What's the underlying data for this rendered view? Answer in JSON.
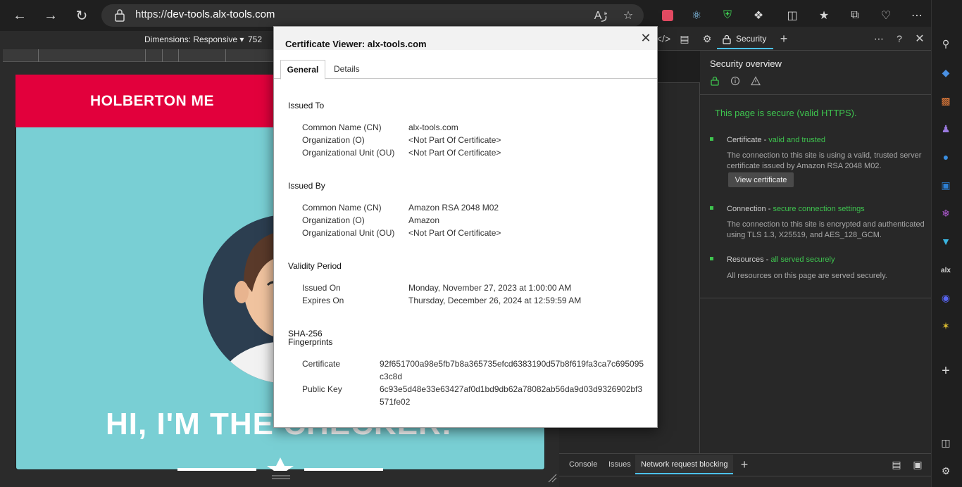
{
  "browser": {
    "url_scheme": "https://",
    "url_host": "dev-tools.alx-tools.com"
  },
  "device_toolbar": {
    "dimensions_label": "Dimensions: Responsive ▾",
    "width": "752"
  },
  "page": {
    "brand": "HOLBERTON ME",
    "hero": "HI, I'M THE CHECKER!"
  },
  "devtools": {
    "security_tab": "Security",
    "security_overview_title": "Security overview",
    "main_status": "This page is secure (valid HTTPS).",
    "certificate": {
      "head": "Certificate - ",
      "status": "valid and trusted",
      "desc": "The connection to this site is using a valid, trusted server certificate issued by Amazon RSA 2048 M02.",
      "button": "View certificate"
    },
    "connection": {
      "head": "Connection - ",
      "status": "secure connection settings",
      "desc": "The connection to this site is encrypted and authenticated using TLS 1.3, X25519, and AES_128_GCM."
    },
    "resources": {
      "head": "Resources - ",
      "status": "all served securely",
      "desc": "All resources on this page are served securely."
    },
    "drawer_tabs": [
      "Console",
      "Issues",
      "Network request blocking"
    ]
  },
  "cert_dialog": {
    "title": "Certificate Viewer: alx-tools.com",
    "tabs": [
      "General",
      "Details"
    ],
    "issued_to": {
      "heading": "Issued To",
      "rows": [
        {
          "label": "Common Name (CN)",
          "value": "alx-tools.com"
        },
        {
          "label": "Organization (O)",
          "value": "<Not Part Of Certificate>"
        },
        {
          "label": "Organizational Unit (OU)",
          "value": "<Not Part Of Certificate>"
        }
      ]
    },
    "issued_by": {
      "heading": "Issued By",
      "rows": [
        {
          "label": "Common Name (CN)",
          "value": "Amazon RSA 2048 M02"
        },
        {
          "label": "Organization (O)",
          "value": "Amazon"
        },
        {
          "label": "Organizational Unit (OU)",
          "value": "<Not Part Of Certificate>"
        }
      ]
    },
    "validity": {
      "heading": "Validity Period",
      "rows": [
        {
          "label": "Issued On",
          "value": "Monday, November 27, 2023 at 1:00:00 AM"
        },
        {
          "label": "Expires On",
          "value": "Thursday, December 26, 2024 at 12:59:59 AM"
        }
      ]
    },
    "fingerprints": {
      "heading_line1": "SHA-256",
      "heading_line2": "Fingerprints",
      "rows": [
        {
          "label": "Certificate",
          "value": "92f651700a98e5fb7b8a365735efcd6383190d57b8f619fa3ca7c695095c3c8d"
        },
        {
          "label": "Public Key",
          "value": "6c93e5d48e33e63427af0d1bd9db62a78082ab56da9d03d9326902bf3571fe02"
        }
      ]
    }
  },
  "colors": {
    "brand_red": "#e2003c",
    "page_teal": "#79cfd4",
    "secure_green": "#3ec44f",
    "accent_blue": "#4cc2ff"
  }
}
